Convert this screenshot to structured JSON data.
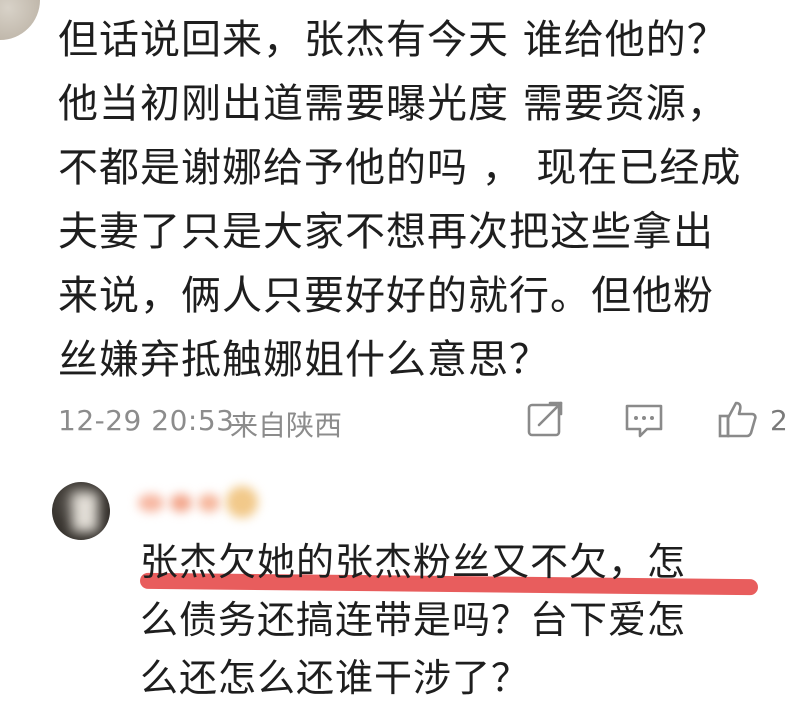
{
  "comment": {
    "lines": [
      "但话说回来，张杰有今天 谁给他的？",
      "他当初刚出道需要曝光度 需要资源，",
      "不都是谢娜给予他的吗 ，  现在已经成",
      "夫妻了只是大家不想再次把这些拿出",
      "来说，俩人只要好好的就行。但他粉",
      "丝嫌弃抵触娜姐什么意思？"
    ],
    "timestamp": "12-29 20:53",
    "location": "来自陕西",
    "like_count": "2"
  },
  "icons": {
    "share": "share-icon",
    "reply": "comment-icon",
    "like": "thumbs-up-icon"
  },
  "reply": {
    "lines": [
      "张杰欠她的张杰粉丝又不欠，怎",
      "么债务还搞连带是吗？台下爱怎",
      "么还怎么还谁干涉了？"
    ]
  },
  "colors": {
    "text": "#1e1e1e",
    "meta": "#8c8c8c",
    "highlight": "#e44141"
  }
}
